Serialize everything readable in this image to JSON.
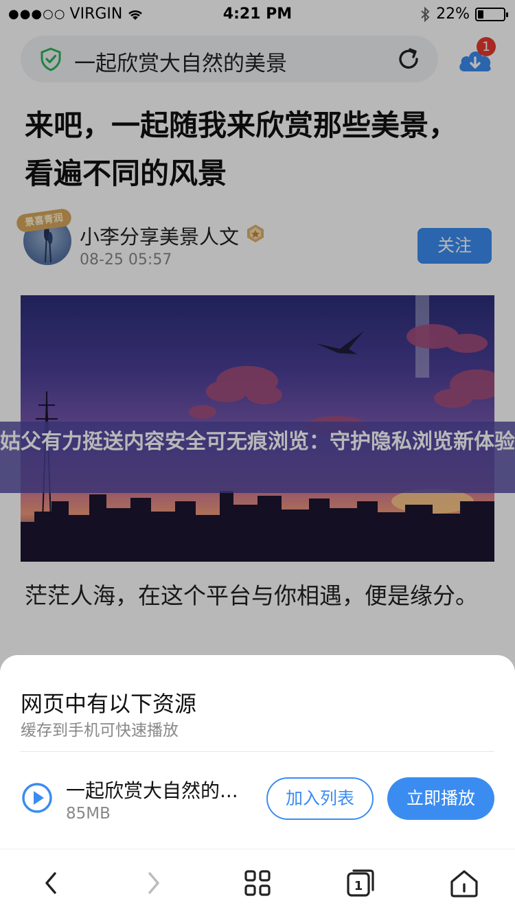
{
  "status_bar": {
    "signal": "●●●○○",
    "carrier": "VIRGIN",
    "time": "4:21 PM",
    "battery_text": "22%",
    "battery_level": 0.22
  },
  "search": {
    "text": "一起欣赏大自然的美景"
  },
  "download": {
    "badge": "1"
  },
  "article": {
    "headline": "来吧，一起随我来欣赏那些美景，看遍不同的风景",
    "author_name": "小李分享美景人文",
    "avatar_frame_text": "景喜青润",
    "date": "08-25 05:57",
    "follow_label": "关注",
    "watermark": "姑父有力挺送内容安全可无痕浏览：守护隐私浏览新体验",
    "body": "茫茫人海，在这个平台与你相遇，便是缘分。"
  },
  "sheet": {
    "title": "网页中有以下资源",
    "subtitle": "缓存到手机可快速播放",
    "resource_name": "一起欣赏大自然的...",
    "resource_size": "85MB",
    "add_label": "加入列表",
    "play_label": "立即播放"
  },
  "toolbar": {
    "tabs_count": "1"
  },
  "colors": {
    "accent": "#3b8cf0",
    "badge": "#e8392e",
    "shield": "#2fb55a"
  }
}
